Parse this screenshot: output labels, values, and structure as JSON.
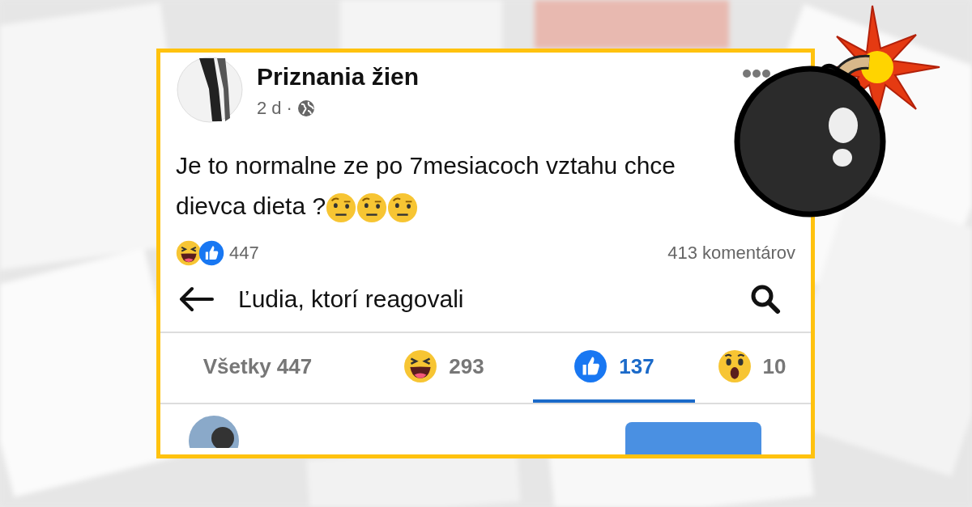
{
  "post": {
    "page_name": "Priznania žien",
    "time": "2 d",
    "separator": "·",
    "text": "Je to normalne ze po 7mesiacoch vztahu chce dievca dieta ?",
    "emojis": [
      {
        "kind": "raised-eyebrow"
      },
      {
        "kind": "raised-eyebrow"
      },
      {
        "kind": "raised-eyebrow"
      }
    ]
  },
  "summary": {
    "reaction_icons": [
      {
        "kind": "haha"
      },
      {
        "kind": "like"
      }
    ],
    "count": "447",
    "comments": "413 komentárov"
  },
  "reactions_panel": {
    "title": "Ľudia, ktorí reagovali",
    "tabs": [
      {
        "kind": "all",
        "label": "Všetky 447",
        "selected": false
      },
      {
        "kind": "haha",
        "label": "293",
        "selected": false
      },
      {
        "kind": "like",
        "label": "137",
        "selected": true
      },
      {
        "kind": "wow",
        "label": "10",
        "selected": false
      }
    ]
  }
}
